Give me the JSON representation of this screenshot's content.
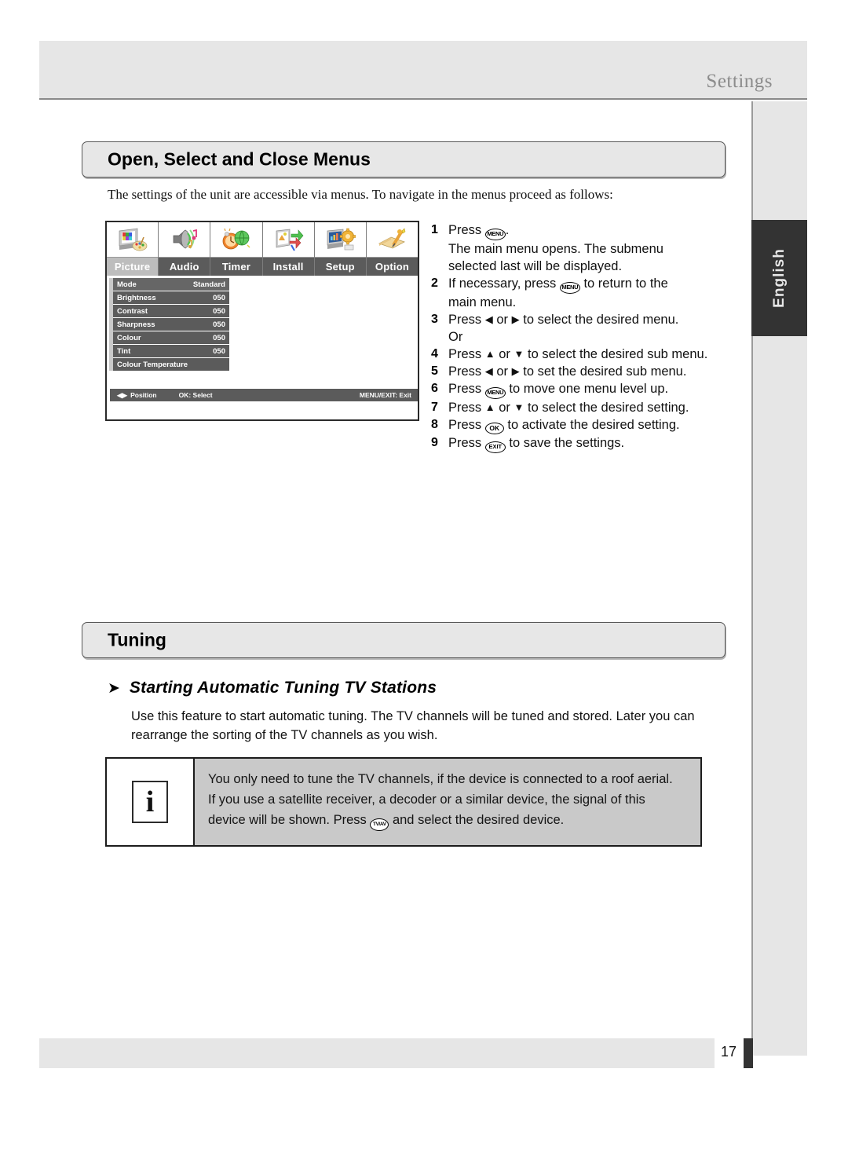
{
  "header": {
    "title": "Settings"
  },
  "sidebar": {
    "language_tab": "English"
  },
  "footer": {
    "page_number": "17"
  },
  "sections": [
    {
      "id": "open-select-close",
      "title": "Open, Select and Close Menus"
    },
    {
      "id": "tuning",
      "title": "Tuning"
    }
  ],
  "intro": "The settings of the unit are accessible via menus. To navigate in the menus proceed as follows:",
  "osd": {
    "tabs": [
      {
        "label": "Picture",
        "icon": "tv-palette-icon",
        "selected": true
      },
      {
        "label": "Audio",
        "icon": "speaker-music-icon",
        "selected": false
      },
      {
        "label": "Timer",
        "icon": "clock-globe-icon",
        "selected": false
      },
      {
        "label": "Install",
        "icon": "tv-arrows-icon",
        "selected": false
      },
      {
        "label": "Setup",
        "icon": "monitor-gear-icon",
        "selected": false
      },
      {
        "label": "Option",
        "icon": "book-pencil-icon",
        "selected": false
      }
    ],
    "rows": [
      {
        "label": "Mode",
        "value": "Standard"
      },
      {
        "label": "Brightness",
        "value": "050"
      },
      {
        "label": "Contrast",
        "value": "050"
      },
      {
        "label": "Sharpness",
        "value": "050"
      },
      {
        "label": "Colour",
        "value": "050"
      },
      {
        "label": "Tint",
        "value": "050"
      },
      {
        "label": "Colour Temperature",
        "value": ""
      }
    ],
    "status": {
      "position_label": "Position",
      "position_icon": "left-right-arrows-icon",
      "select_label": "OK: Select",
      "exit_label": "MENU/EXIT: Exit"
    }
  },
  "steps": {
    "s1_num": "1",
    "s1_a": "Press",
    "s1_key": "MENU",
    "s1_b": ".",
    "s1_line2": "The main menu opens. The submenu",
    "s1_line3": "selected last will be displayed.",
    "s2_num": "2",
    "s2_a": "If necessary, press",
    "s2_key": "MENU",
    "s2_b": "to return to the",
    "s2_line2": "main menu.",
    "s3_num": "3",
    "s3_a": "Press",
    "s3_left": "◀",
    "s3_or": "or",
    "s3_right": "▶",
    "s3_b": "to select the desired menu.",
    "s3_line2": "Or",
    "s4_num": "4",
    "s4_a": "Press",
    "s4_up": "▲",
    "s4_or": "or",
    "s4_down": "▼",
    "s4_b": "to select the desired sub menu.",
    "s5_num": "5",
    "s5_a": "Press",
    "s5_left": "◀",
    "s5_or": "or",
    "s5_right": "▶",
    "s5_b": "to set the desired sub menu.",
    "s6_num": "6",
    "s6_a": "Press",
    "s6_key": "MENU",
    "s6_b": "to move one menu level up.",
    "s7_num": "7",
    "s7_a": "Press",
    "s7_up": "▲",
    "s7_or": "or",
    "s7_down": "▼",
    "s7_b": "to select the desired setting.",
    "s8_num": "8",
    "s8_a": "Press",
    "s8_key": "OK",
    "s8_b": "to activate the desired setting.",
    "s9_num": "9",
    "s9_a": "Press",
    "s9_key": "EXIT",
    "s9_b": "to save the settings."
  },
  "subsection": {
    "chevron": "➤",
    "title": "Starting Automatic Tuning TV Stations",
    "paragraph": "Use this feature to start automatic tuning. The TV channels will be tuned and stored. Later you can rearrange the sorting of the TV channels as you wish."
  },
  "note": {
    "icon": "info-icon",
    "icon_glyph": "i",
    "line1": "You only need to tune the TV channels, if the device is connected to a roof aerial.",
    "line2": "If you use a satellite receiver, a decoder or a similar device, the signal of this",
    "line3_a": "device will be shown. Press",
    "line3_key": "TV/AV",
    "line3_b": "and select the desired device."
  },
  "colors": {
    "band_gray": "#e6e6e6",
    "osd_bar_gray": "#5b5b5b",
    "note_gray": "#c9c9c9",
    "tab_dark": "#333333"
  }
}
